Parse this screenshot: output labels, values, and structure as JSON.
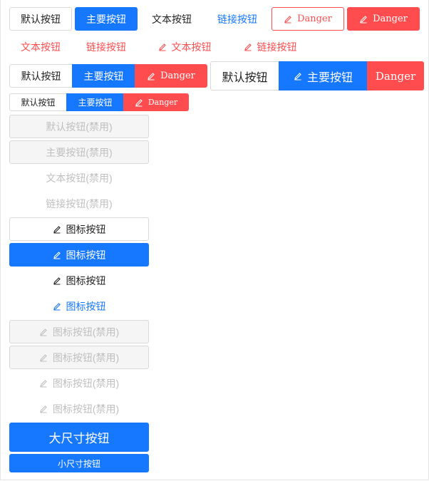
{
  "row1": {
    "default": "默认按钮",
    "primary": "主要按钮",
    "text": "文本按钮",
    "link": "链接按钮",
    "danger_outline": "Danger",
    "danger_filled": "Danger"
  },
  "row2": {
    "danger_text": "文本按钮",
    "danger_link": "链接按钮",
    "danger_text_icon": "文本按钮",
    "danger_link_icon": "链接按钮"
  },
  "group_medium": {
    "default": "默认按钮",
    "primary": "主要按钮",
    "danger": "Danger"
  },
  "group_large": {
    "default": "默认按钮",
    "primary": "主要按钮",
    "danger": "Danger"
  },
  "group_small": {
    "default": "默认按钮",
    "primary": "主要按钮",
    "danger": "Danger"
  },
  "disabled": {
    "default": "默认按钮(禁用)",
    "primary": "主要按钮(禁用)",
    "text": "文本按钮(禁用)",
    "link": "链接按钮(禁用)"
  },
  "icon_buttons": {
    "default": "图标按钮",
    "primary": "图标按钮",
    "text": "图标按钮",
    "link": "图标按钮"
  },
  "icon_disabled": {
    "default": "图标按钮(禁用)",
    "primary": "图标按钮(禁用)",
    "text": "图标按钮(禁用)",
    "link": "图标按钮(禁用)"
  },
  "sizes": {
    "large": "大尺寸按钮",
    "small": "小尺寸按钮"
  },
  "icons": {
    "pencil": "edit-icon"
  },
  "colors": {
    "primary": "#1677ff",
    "danger": "#ff4d4f",
    "disabled": "#bfbfbf"
  }
}
